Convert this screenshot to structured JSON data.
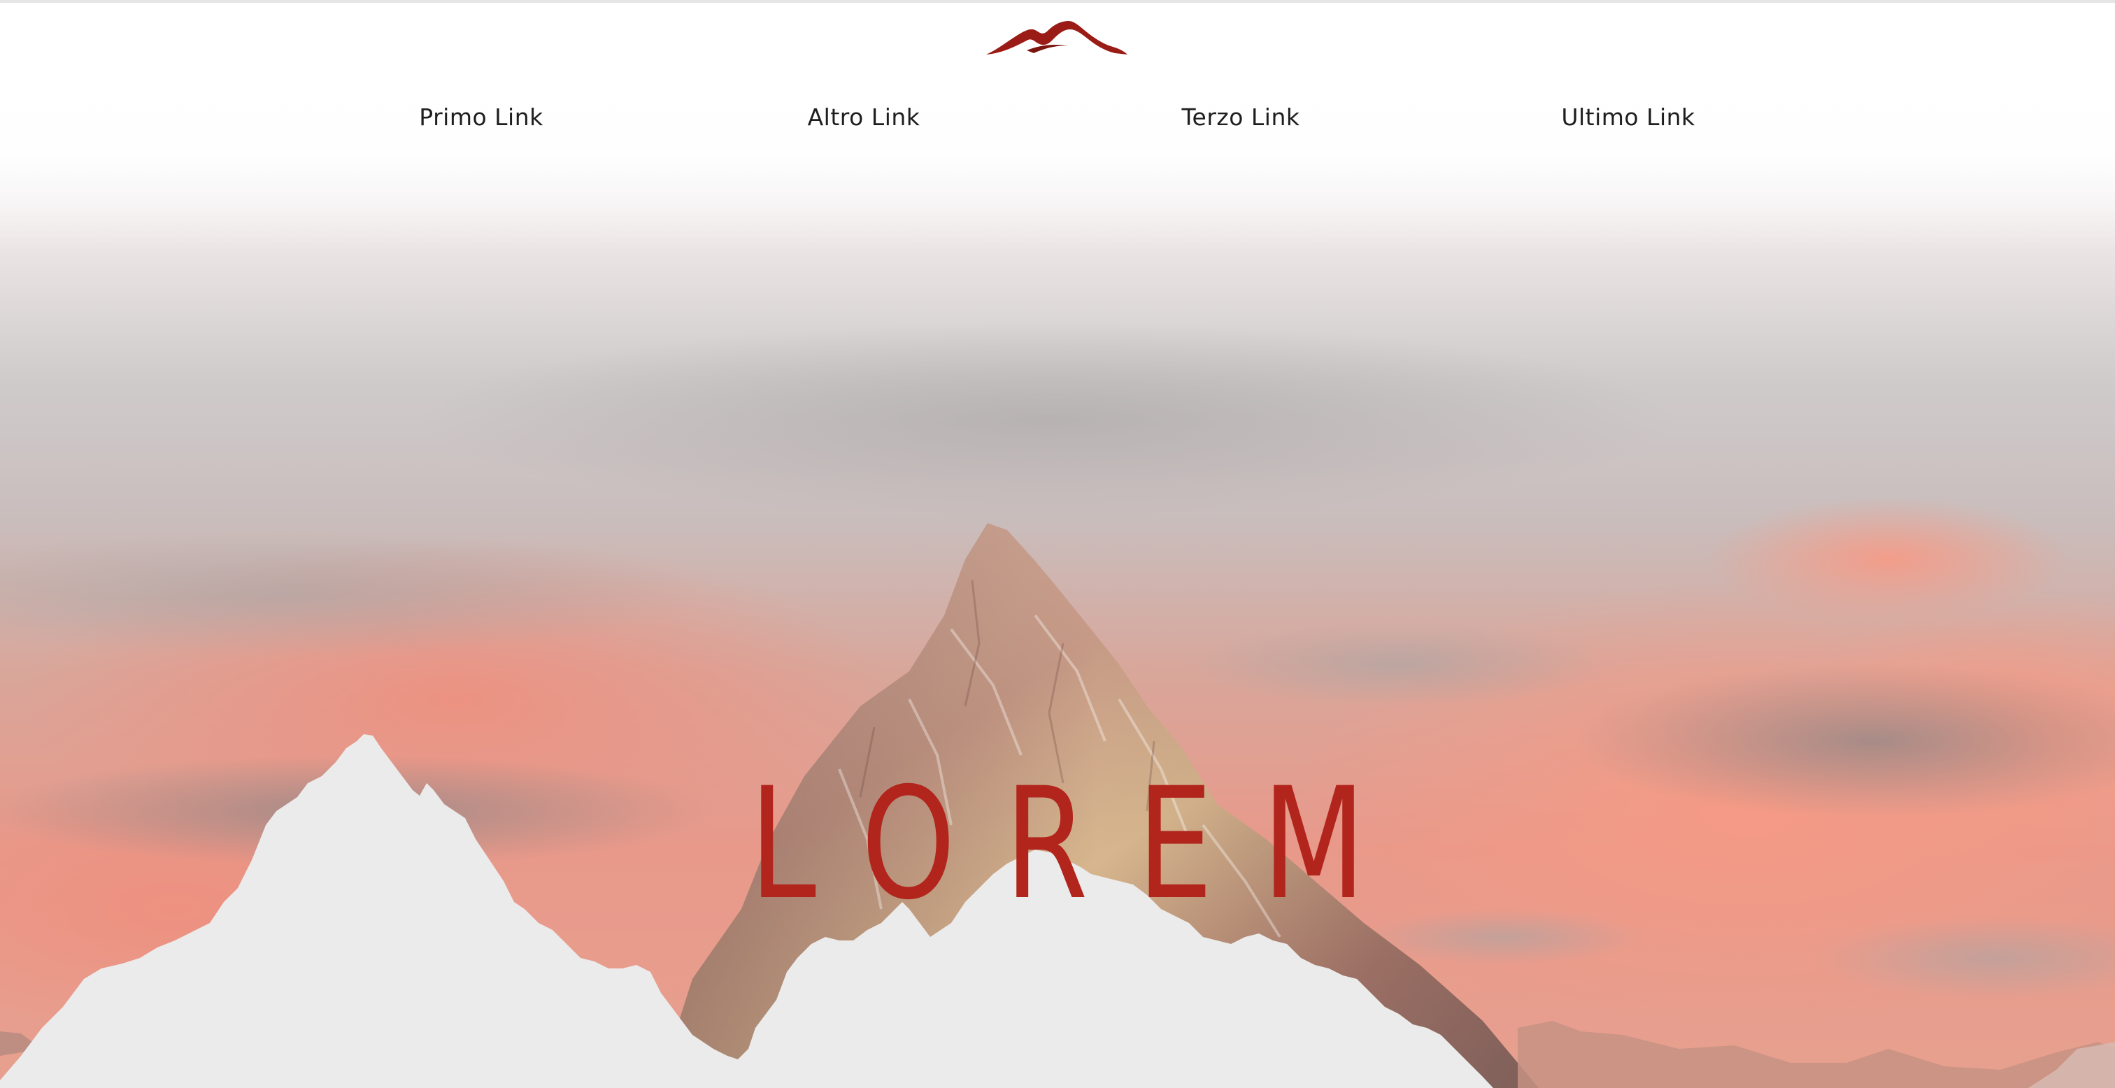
{
  "brand": {
    "logo_icon": "mountain-logo-icon",
    "accent_color": "#b2251c",
    "logo_color": "#9b1c16"
  },
  "nav": {
    "links": [
      {
        "label": "Primo Link"
      },
      {
        "label": "Altro Link"
      },
      {
        "label": "Terzo Link"
      },
      {
        "label": "Ultimo Link"
      }
    ]
  },
  "hero": {
    "title": "LOREM",
    "background": "mountain-sunset-photo",
    "foreground": "snow-mountain-silhouette",
    "foreground_color": "#ebebeb"
  }
}
